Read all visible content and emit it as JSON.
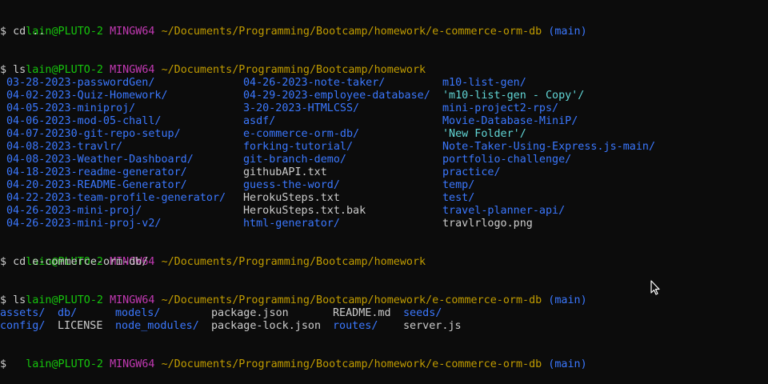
{
  "theme": {
    "background": "#0c0c0c",
    "text": "#cccccc",
    "user_color": "#16c60c",
    "system_color": "#c239b3",
    "path_color": "#c19c00",
    "branch_color": "#3b78ff",
    "directory_color": "#3b78ff",
    "quoted_color": "#61d6d6"
  },
  "prompts": [
    {
      "user": "lain@PLUTO-2",
      "system": "MINGW64",
      "path": "~/Documents/Programming/Bootcamp/homework/e-commerce-orm-db",
      "branch": "(main)"
    },
    {
      "user": "lain@PLUTO-2",
      "system": "MINGW64",
      "path": "~/Documents/Programming/Bootcamp/homework",
      "branch": ""
    },
    {
      "user": "lain@PLUTO-2",
      "system": "MINGW64",
      "path": "~/Documents/Programming/Bootcamp/homework",
      "branch": ""
    },
    {
      "user": "lain@PLUTO-2",
      "system": "MINGW64",
      "path": "~/Documents/Programming/Bootcamp/homework/e-commerce-orm-db",
      "branch": "(main)"
    },
    {
      "user": "lain@PLUTO-2",
      "system": "MINGW64",
      "path": "~/Documents/Programming/Bootcamp/homework/e-commerce-orm-db",
      "branch": "(main)"
    }
  ],
  "commands": [
    "$ cd ..",
    "$ ls",
    "$ cd e-commerce-orm-db/",
    "$ ls",
    "$"
  ],
  "listing1": {
    "col1": [
      {
        "name": "03-28-2023-passwordGen/",
        "kind": "dir"
      },
      {
        "name": "04-02-2023-Quiz-Homework/",
        "kind": "dir"
      },
      {
        "name": "04-05-2023-miniproj/",
        "kind": "dir"
      },
      {
        "name": "04-06-2023-mod-05-chall/",
        "kind": "dir"
      },
      {
        "name": "04-07-20230-git-repo-setup/",
        "kind": "dir"
      },
      {
        "name": "04-08-2023-travlr/",
        "kind": "dir"
      },
      {
        "name": "04-08-2023-Weather-Dashboard/",
        "kind": "dir"
      },
      {
        "name": "04-18-2023-readme-generator/",
        "kind": "dir"
      },
      {
        "name": "04-20-2023-README-Generator/",
        "kind": "dir"
      },
      {
        "name": "04-22-2023-team-profile-generator/",
        "kind": "dir"
      },
      {
        "name": "04-26-2023-mini-proj/",
        "kind": "dir"
      },
      {
        "name": "04-26-2023-mini-proj-v2/",
        "kind": "dir"
      }
    ],
    "col2": [
      {
        "name": "04-26-2023-note-taker/",
        "kind": "dir"
      },
      {
        "name": "04-29-2023-employee-database/",
        "kind": "dir"
      },
      {
        "name": "3-20-2023-HTMLCSS/",
        "kind": "dir"
      },
      {
        "name": "asdf/",
        "kind": "dir"
      },
      {
        "name": "e-commerce-orm-db/",
        "kind": "dir"
      },
      {
        "name": "forking-tutorial/",
        "kind": "dir"
      },
      {
        "name": "git-branch-demo/",
        "kind": "dir"
      },
      {
        "name": "githubAPI.txt",
        "kind": "file"
      },
      {
        "name": "guess-the-word/",
        "kind": "dir"
      },
      {
        "name": "HerokuSteps.txt",
        "kind": "file"
      },
      {
        "name": "HerokuSteps.txt.bak",
        "kind": "file"
      },
      {
        "name": "html-generator/",
        "kind": "dir"
      }
    ],
    "col3": [
      {
        "name": "m10-list-gen/",
        "kind": "dir"
      },
      {
        "name": "'m10-list-gen - Copy'/",
        "kind": "quoted"
      },
      {
        "name": "mini-project2-rps/",
        "kind": "dir"
      },
      {
        "name": "Movie-Database-MiniP/",
        "kind": "dir"
      },
      {
        "name": "'New Folder'/",
        "kind": "quoted"
      },
      {
        "name": "Note-Taker-Using-Express.js-main/",
        "kind": "dir"
      },
      {
        "name": "portfolio-challenge/",
        "kind": "dir"
      },
      {
        "name": "practice/",
        "kind": "dir"
      },
      {
        "name": "temp/",
        "kind": "dir"
      },
      {
        "name": "test/",
        "kind": "dir"
      },
      {
        "name": "travel-planner-api/",
        "kind": "dir"
      },
      {
        "name": "travlrlogo.png",
        "kind": "file"
      }
    ]
  },
  "listing2": {
    "row1": [
      {
        "name": "assets/",
        "kind": "dir"
      },
      {
        "name": "db/",
        "kind": "dir"
      },
      {
        "name": "models/",
        "kind": "dir"
      },
      {
        "name": "package.json",
        "kind": "file"
      },
      {
        "name": "README.md",
        "kind": "file"
      },
      {
        "name": "seeds/",
        "kind": "dir"
      }
    ],
    "row2": [
      {
        "name": "config/",
        "kind": "dir"
      },
      {
        "name": "LICENSE",
        "kind": "file"
      },
      {
        "name": "node_modules/",
        "kind": "dir"
      },
      {
        "name": "package-lock.json",
        "kind": "file"
      },
      {
        "name": "routes/",
        "kind": "dir"
      },
      {
        "name": "server.js",
        "kind": "file"
      }
    ]
  },
  "mouse_cursor_icon": "arrow-pointer-icon"
}
